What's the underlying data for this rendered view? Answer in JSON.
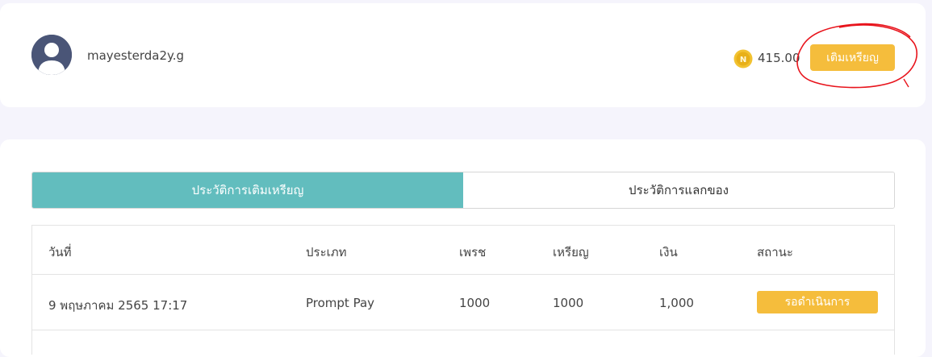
{
  "user": {
    "username": "mayesterda2y.g",
    "coin_balance": "415.00",
    "coin_icon_letter": "N",
    "topup_label": "เติมเหรียญ"
  },
  "tabs": [
    {
      "label": "ประวัติการเติมเหรียญ",
      "active": true
    },
    {
      "label": "ประวัติการแลกของ",
      "active": false
    }
  ],
  "table": {
    "headers": [
      "วันที่",
      "ประเภท",
      "เพรช",
      "เหรียญ",
      "เงิน",
      "สถานะ"
    ],
    "rows": [
      [
        "9 พฤษภาคม 2565 17:17",
        "Prompt Pay",
        "1000",
        "1000",
        "1,000",
        "รอดำเนินการ"
      ]
    ]
  },
  "colors": {
    "accent_teal": "#62bdbe",
    "button_yellow": "#f5bd3c",
    "annotation_red": "#e8141c",
    "background": "#f5f4fc"
  }
}
